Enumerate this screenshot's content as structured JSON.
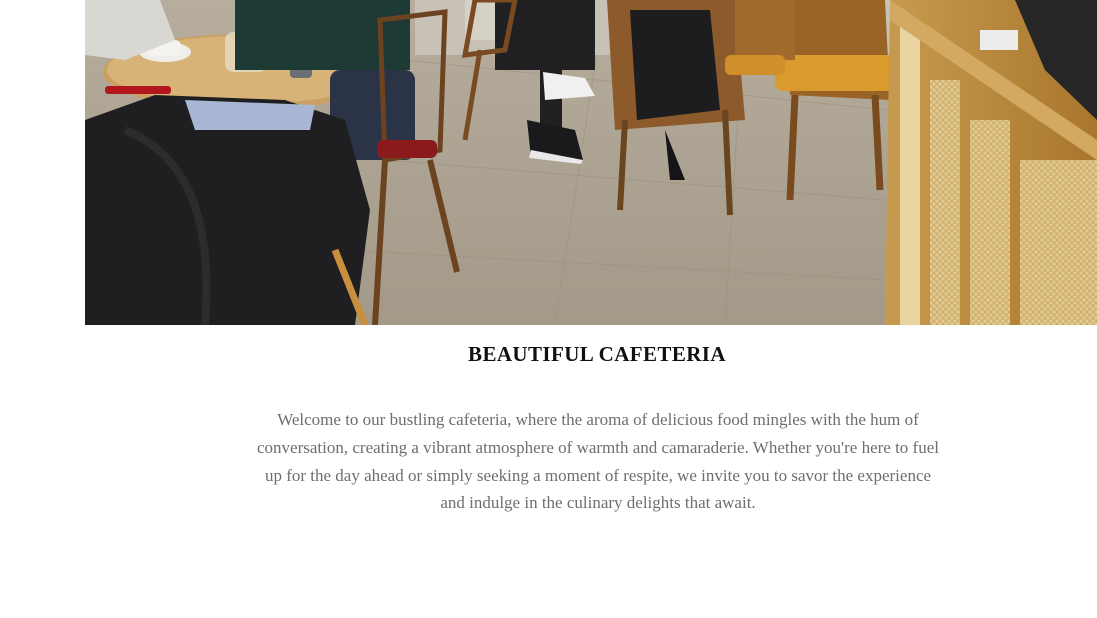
{
  "section": {
    "title": "BEAUTIFUL CAFETERIA",
    "description": "Welcome to our bustling cafeteria, where the aroma of delicious food mingles with the hum of conversation, creating a vibrant atmosphere of warmth and camaraderie. Whether you're here to fuel up for the day ahead or simply seeking a moment of respite, we invite you to savor the experience and indulge in the culinary delights that await."
  },
  "colors": {
    "title": "#111111",
    "text": "#6e6e6e",
    "background": "#ffffff"
  }
}
